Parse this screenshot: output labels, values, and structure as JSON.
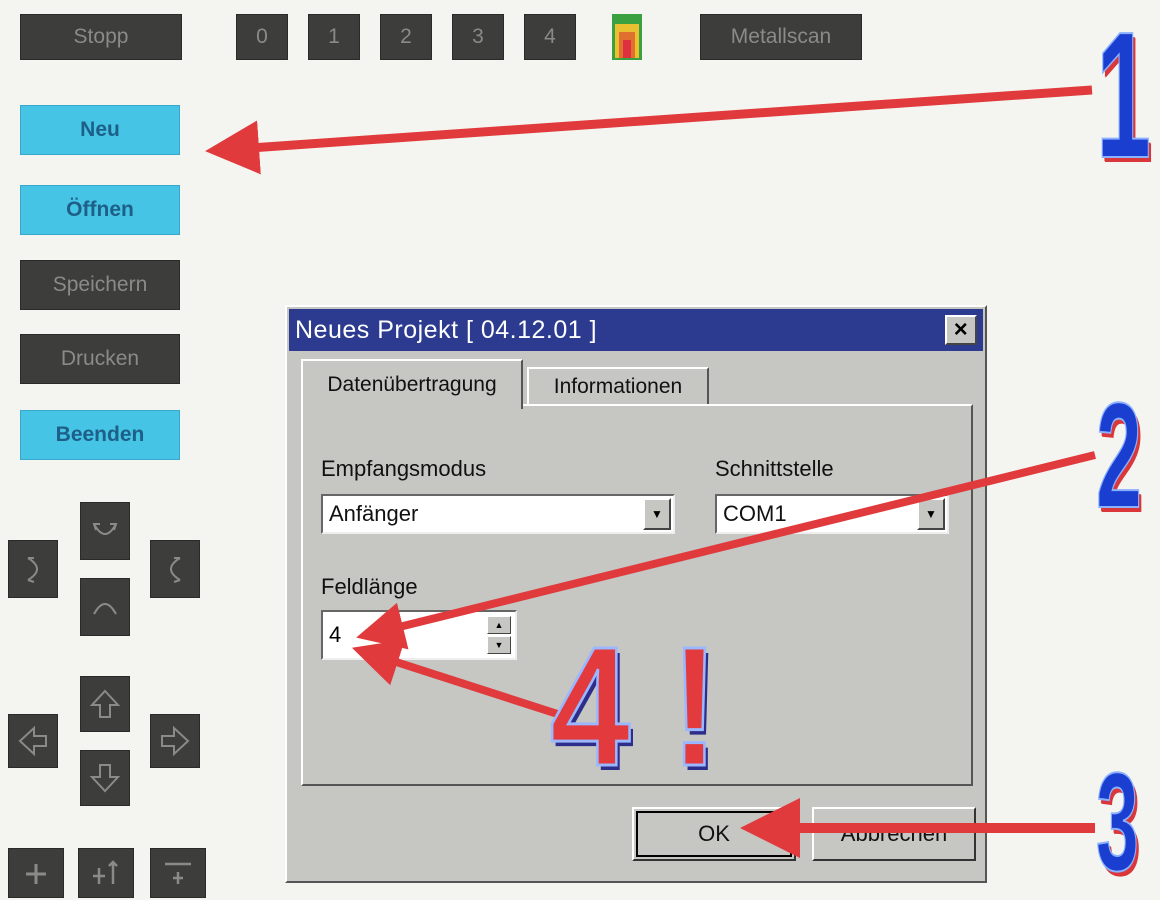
{
  "toolbar": {
    "stop_label": "Stopp",
    "num_buttons": [
      "0",
      "1",
      "2",
      "3",
      "4"
    ],
    "metalscan_label": "Metallscan",
    "scan_icon": "heatmap-icon"
  },
  "sidebar": {
    "neu": "Neu",
    "oeffnen": "Öffnen",
    "speichern": "Speichern",
    "drucken": "Drucken",
    "beenden": "Beenden"
  },
  "nav_icons": [
    "rotate-up-icon",
    "rotate-left-icon",
    "rotate-right-icon",
    "rotate-down-icon",
    "arrow-up-icon",
    "arrow-left-icon",
    "arrow-right-icon",
    "arrow-down-icon",
    "zoom-in-icon",
    "scale-up-icon",
    "zoom-out-icon"
  ],
  "dialog": {
    "title": "Neues Projekt  [ 04.12.01 ]",
    "close": "×",
    "tabs": [
      "Datenübertragung",
      "Informationen"
    ],
    "mode_label": "Empfangsmodus",
    "mode_value": "Anfänger",
    "port_label": "Schnittstelle",
    "port_value": "COM1",
    "length_label": "Feldlänge",
    "length_value": "4",
    "ok": "OK",
    "cancel": "Abbrechen"
  },
  "annotations": {
    "n1": "1",
    "n2": "2",
    "n3": "3",
    "big": "4 !"
  },
  "colors": {
    "arrow": "#e03a3c",
    "annotation_blue": "#1a3fd0",
    "cyan_button": "#45c4e6",
    "dark_button": "#3d3d3b",
    "titlebar": "#2c3b8f"
  }
}
